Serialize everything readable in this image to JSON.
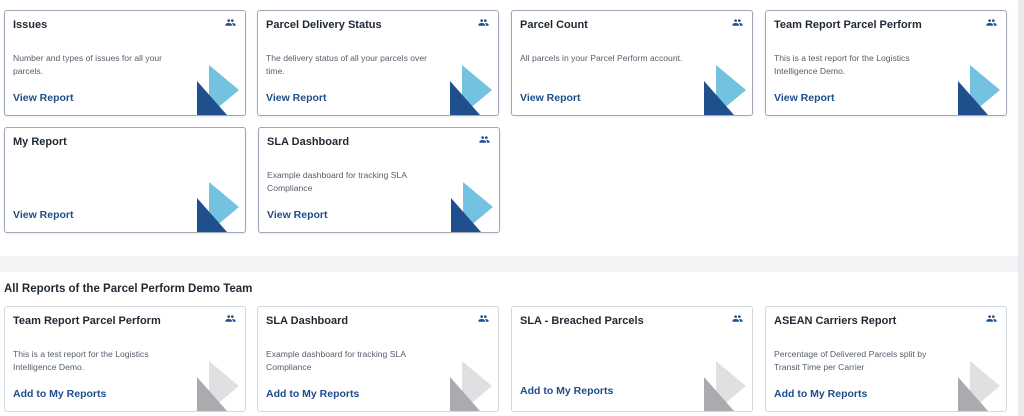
{
  "my_reports": [
    {
      "title": "Issues",
      "description": "Number and types of issues for all your parcels.",
      "link": "View Report",
      "shared": true
    },
    {
      "title": "Parcel Delivery Status",
      "description": "The delivery status of all your parcels over time.",
      "link": "View Report",
      "shared": true
    },
    {
      "title": "Parcel Count",
      "description": "All parcels in your Parcel Perform account.",
      "link": "View Report",
      "shared": true
    },
    {
      "title": "Team Report Parcel Perform",
      "description": "This is a test report for the Logistics Intelligence Demo.",
      "link": "View Report",
      "shared": true
    },
    {
      "title": "My Report",
      "description": "",
      "link": "View Report",
      "shared": false
    },
    {
      "title": "SLA Dashboard",
      "description": "Example dashboard for tracking SLA Compliance",
      "link": "View Report",
      "shared": true
    }
  ],
  "team_section": {
    "heading": "All Reports of the Parcel Perform Demo Team",
    "reports": [
      {
        "title": "Team Report Parcel Perform",
        "description": "This is a test report for the Logistics Intelligence Demo.",
        "link": "Add to My Reports",
        "shared": true
      },
      {
        "title": "SLA Dashboard",
        "description": "Example dashboard for tracking SLA Compliance",
        "link": "Add to My Reports",
        "shared": true
      },
      {
        "title": "SLA - Breached Parcels",
        "description": "",
        "link": "Add to My Reports",
        "shared": true
      },
      {
        "title": "ASEAN Carriers Report",
        "description": "Percentage of Delivered Parcels split by Transit Time per Carrier",
        "link": "Add to My Reports",
        "shared": true
      }
    ]
  },
  "icons": {
    "team": "team-icon",
    "logo": "parcel-perform-logo-icon"
  },
  "colors": {
    "link": "#1d4d8a",
    "logo_dark": "#1f4f8c",
    "logo_light": "#72c2e0",
    "logo_grey_dark": "#a9abaf",
    "logo_grey_light": "#dfe0e2"
  }
}
